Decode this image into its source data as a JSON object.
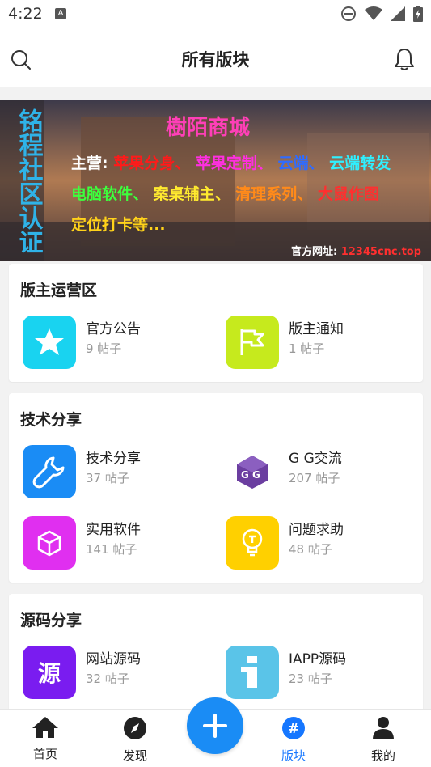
{
  "status_bar": {
    "time": "4:22",
    "app_letter": "A"
  },
  "header": {
    "title": "所有版块"
  },
  "banner": {
    "vertical_text": "铭程社区认证",
    "title": "樹陌商城",
    "line1_prefix": "主营:",
    "line1_items": [
      "苹果分身、",
      "苹果定制、",
      "云端、",
      "云端转发"
    ],
    "line2_items": [
      "电脑软件、",
      "案桌辅主、",
      "清理系列、",
      "大鼠作图"
    ],
    "line3": "定位打卡等...",
    "site_label": "官方网址:",
    "site_url": "12345cnc.top"
  },
  "sections": [
    {
      "title": "版主运营区",
      "items": [
        {
          "name": "官方公告",
          "count": "9 帖子",
          "icon": "star-icon",
          "color": "#19d3f0"
        },
        {
          "name": "版主通知",
          "count": "1 帖子",
          "icon": "flag-icon",
          "color": "#c6ea1d"
        }
      ]
    },
    {
      "title": "技术分享",
      "items": [
        {
          "name": "技术分享",
          "count": "37 帖子",
          "icon": "wrench-icon",
          "color": "#1a8cf5"
        },
        {
          "name": "G G交流",
          "count": "207 帖子",
          "icon": "gg-logo-icon",
          "color": "#ffffff"
        },
        {
          "name": "实用软件",
          "count": "141 帖子",
          "icon": "cube-icon",
          "color": "#e02ff0"
        },
        {
          "name": "问题求助",
          "count": "48 帖子",
          "icon": "lightbulb-icon",
          "color": "#ffd000"
        }
      ]
    },
    {
      "title": "源码分享",
      "items": [
        {
          "name": "网站源码",
          "count": "32 帖子",
          "icon": "source-char-icon",
          "glyph": "源",
          "color": "#7a1cf0"
        },
        {
          "name": "IAPP源码",
          "count": "23 帖子",
          "icon": "iapp-icon",
          "color": "#5ac4e8"
        }
      ]
    }
  ],
  "tabbar": {
    "tabs": [
      {
        "label": "首页",
        "icon": "home-icon"
      },
      {
        "label": "发现",
        "icon": "compass-icon"
      },
      {
        "label": "版块",
        "icon": "hash-icon",
        "active": true
      },
      {
        "label": "我的",
        "icon": "person-icon"
      }
    ],
    "accent": "#1677ff"
  }
}
